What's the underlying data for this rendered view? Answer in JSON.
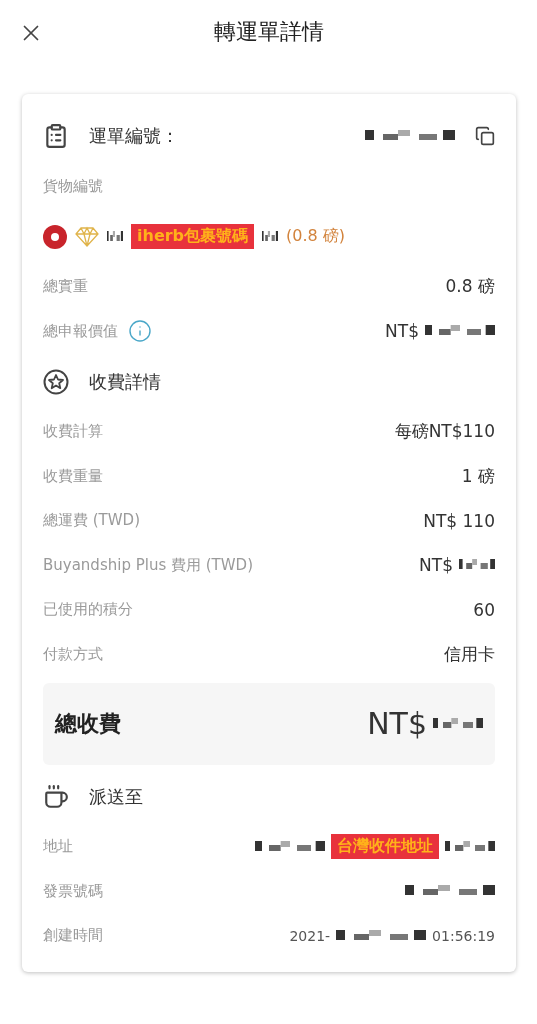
{
  "header": {
    "title": "轉運單詳情"
  },
  "waybill": {
    "label": "運單編號：",
    "redacted": true
  },
  "cargo": {
    "label": "貨物編號",
    "tag": "iherb包裹號碼",
    "weight": "(0.8 磅)"
  },
  "info_rows": [
    {
      "label": "總實重",
      "value": "0.8 磅",
      "info": false,
      "redacted": false
    },
    {
      "label": "總申報價值",
      "value": "NT$",
      "info": true,
      "redacted": true
    }
  ],
  "fees": {
    "title": "收費詳情",
    "rows": [
      {
        "label": "收費計算",
        "value": "每磅NT$110",
        "redacted": false
      },
      {
        "label": "收費重量",
        "value": "1 磅",
        "redacted": false
      },
      {
        "label": "總運費 (TWD)",
        "value": "NT$ 110",
        "redacted": false
      },
      {
        "label": "Buyandship Plus 費用 (TWD)",
        "value": "NT$",
        "redacted": true
      },
      {
        "label": "已使用的積分",
        "value": "60",
        "redacted": false
      },
      {
        "label": "付款方式",
        "value": "信用卡",
        "redacted": false
      }
    ]
  },
  "total": {
    "label": "總收費",
    "value": "NT$",
    "redacted": true
  },
  "delivery": {
    "title": "派送至",
    "rows": [
      {
        "label": "地址",
        "tag": "台灣收件地址",
        "redacted": true
      },
      {
        "label": "發票號碼",
        "redacted": true
      },
      {
        "label": "創建時間",
        "value": "2021-",
        "redacted": true,
        "value_end": "01:56:19"
      }
    ]
  }
}
